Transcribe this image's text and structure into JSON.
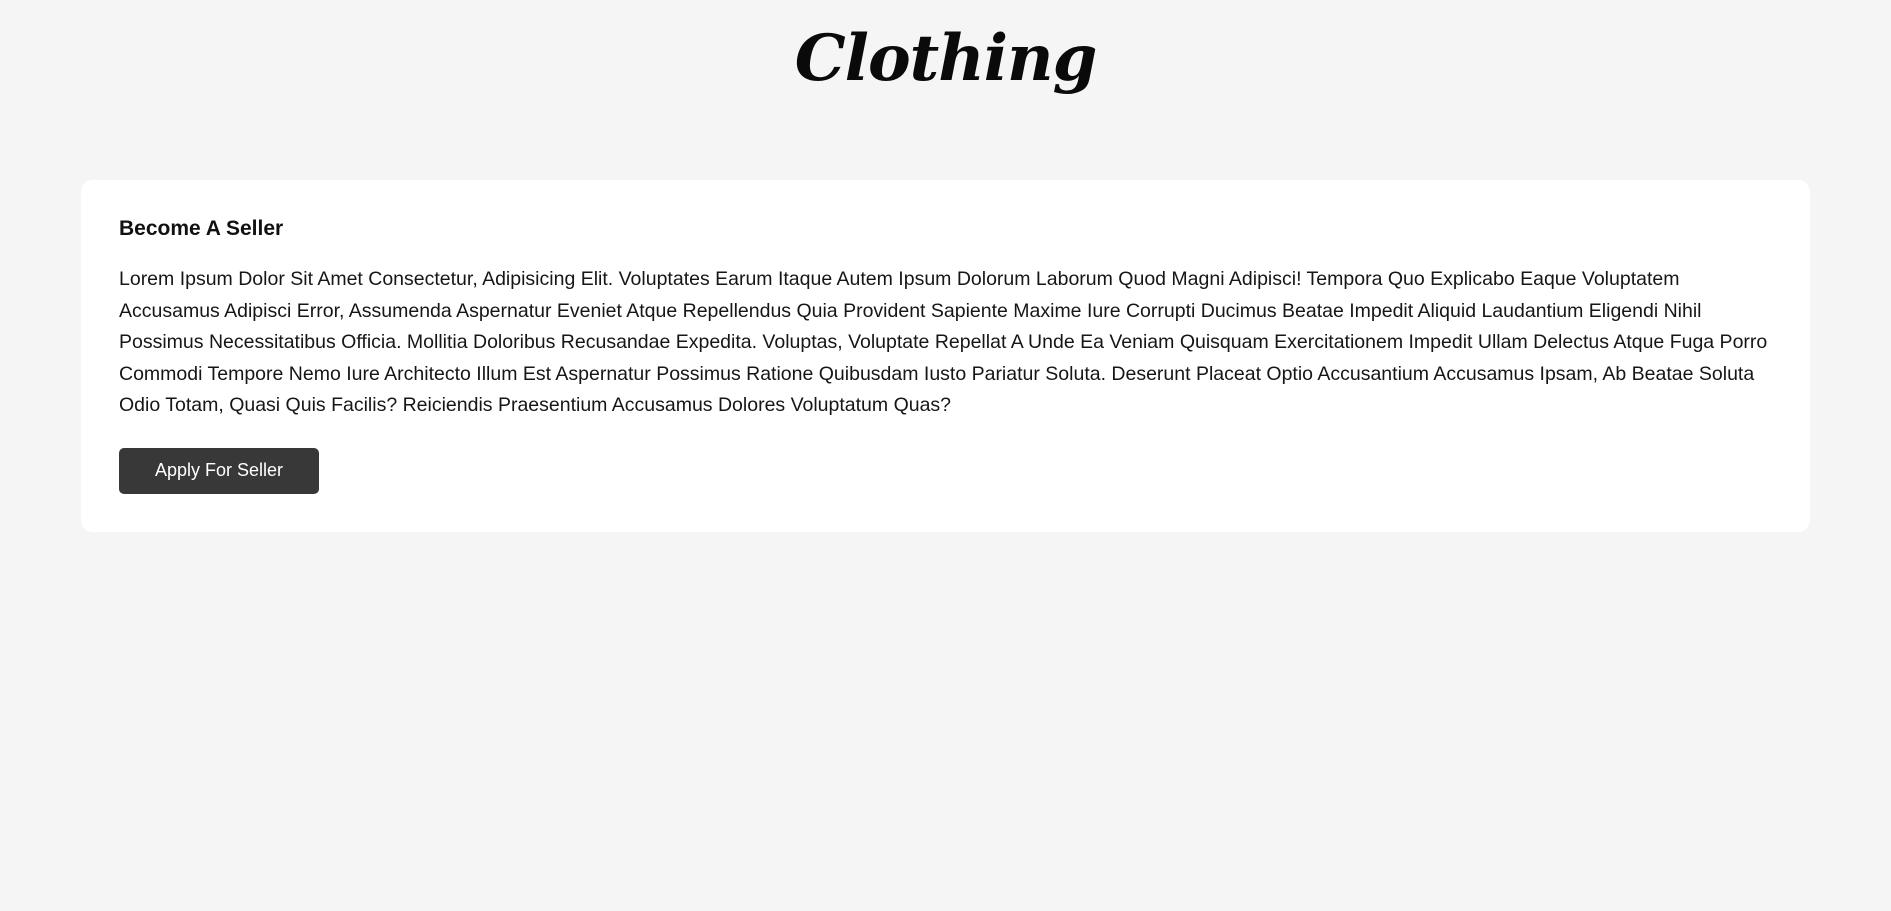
{
  "header": {
    "logo_text": "Clothing"
  },
  "seller_card": {
    "title": "Become A Seller",
    "body": "Lorem Ipsum Dolor Sit Amet Consectetur, Adipisicing Elit. Voluptates Earum Itaque Autem Ipsum Dolorum Laborum Quod Magni Adipisci! Tempora Quo Explicabo Eaque Voluptatem Accusamus Adipisci Error, Assumenda Aspernatur Eveniet Atque Repellendus Quia Provident Sapiente Maxime Iure Corrupti Ducimus Beatae Impedit Aliquid Laudantium Eligendi Nihil Possimus Necessitatibus Officia. Mollitia Doloribus Recusandae Expedita. Voluptas, Voluptate Repellat A Unde Ea Veniam Quisquam Exercitationem Impedit Ullam Delectus Atque Fuga Porro Commodi Tempore Nemo Iure Architecto Illum Est Aspernatur Possimus Ratione Quibusdam Iusto Pariatur Soluta. Deserunt Placeat Optio Accusantium Accusamus Ipsam, Ab Beatae Soluta Odio Totam, Quasi Quis Facilis? Reiciendis Praesentium Accusamus Dolores Voluptatum Quas?",
    "button_label": "Apply For Seller"
  },
  "colors": {
    "page_background": "#f5f5f5",
    "card_background": "#ffffff",
    "button_background": "#383838",
    "button_text": "#ffffff",
    "text": "#111111"
  }
}
